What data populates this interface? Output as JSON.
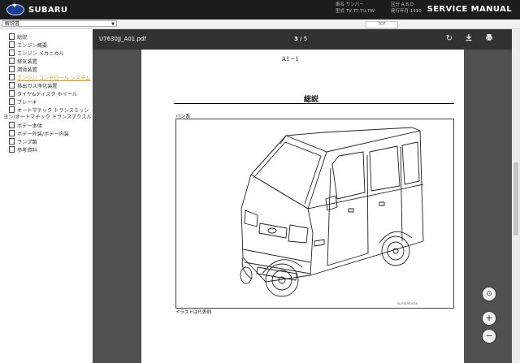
{
  "header": {
    "brand": "SUBARU",
    "title": "SERVICE MANUAL",
    "meta": {
      "model_label": "車名",
      "model_value": "サンバー",
      "type_label": "型式",
      "type_value": "TV,TT,TU,TW",
      "region_label": "区分",
      "region_value": "A,B,D",
      "date_label": "発行年月",
      "date_value": "1410"
    }
  },
  "selector": {
    "value": "解説書",
    "tcf": "TCF"
  },
  "sidebar": {
    "items": [
      {
        "label": "総説",
        "active": false
      },
      {
        "label": "エンジン概要",
        "active": false
      },
      {
        "label": "エンジン メカニカル",
        "active": false
      },
      {
        "label": "排気装置",
        "active": false
      },
      {
        "label": "潤滑装置",
        "active": false
      },
      {
        "label": "エンジン コントロール システム",
        "active": true
      },
      {
        "label": "排出ガス浄化装置",
        "active": false
      },
      {
        "label": "タイヤ&ディスク ホイール",
        "active": false
      },
      {
        "label": "ブレーキ",
        "active": false
      },
      {
        "label": "オートマチック トランスミッシ",
        "active": false
      },
      {
        "label": "ヨン/オートマチック トランスアクスル",
        "active": false,
        "wrap": true
      },
      {
        "label": "ボデー本体",
        "active": false
      },
      {
        "label": "ボデー外装/ボデー内装",
        "active": false
      },
      {
        "label": "ランプ類",
        "active": false
      },
      {
        "label": "参考資料",
        "active": false
      }
    ]
  },
  "viewer": {
    "filename": "U7630JJ_A01.pdf",
    "current_page": "3",
    "page_sep": "/",
    "total_pages": "5",
    "page1_label": "A1－1",
    "page2": {
      "title": "総説",
      "subtitle": "バン系",
      "fig_code": "SU7413E1020",
      "caption": "イラストは代表例"
    }
  },
  "icons": {
    "rotate": "rotate-icon",
    "download": "download-icon",
    "print": "print-icon",
    "fit": "fit-page-icon",
    "zoom_in": "zoom-in-icon",
    "zoom_out": "zoom-out-icon"
  }
}
